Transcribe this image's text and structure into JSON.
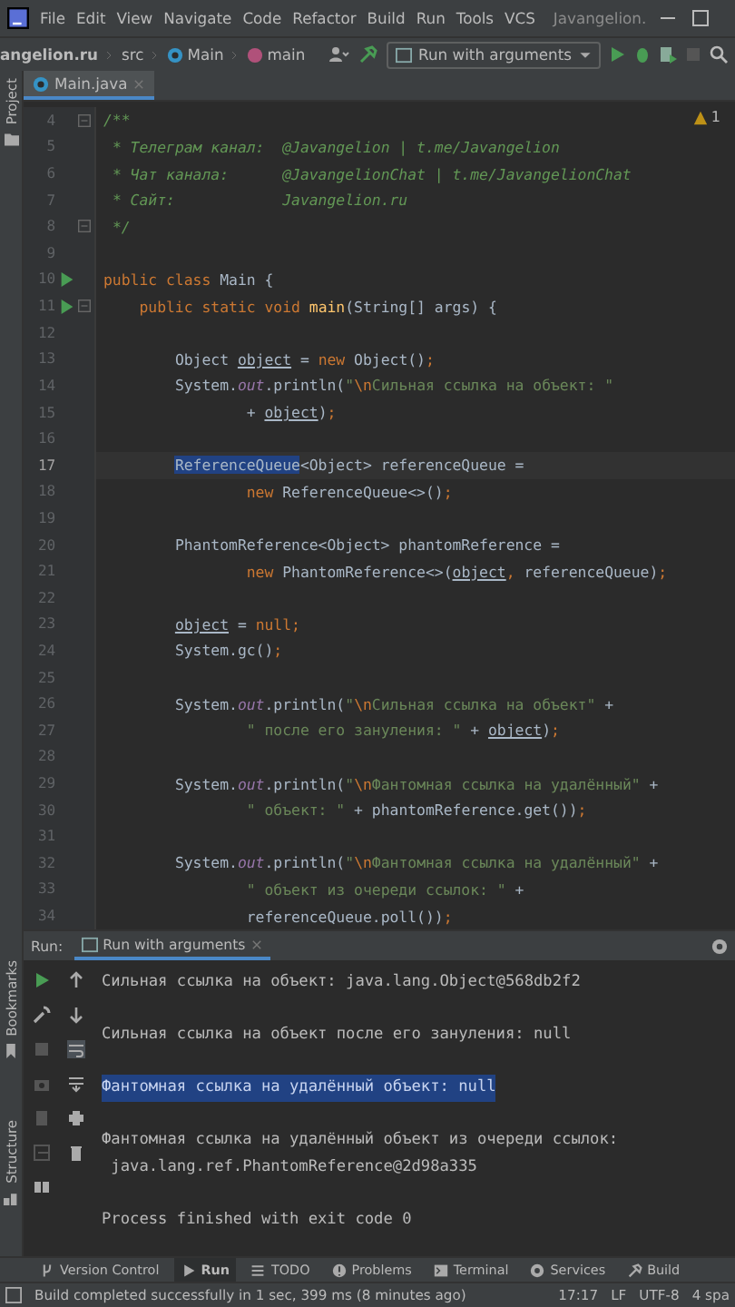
{
  "menu_bar": {
    "items": [
      "File",
      "Edit",
      "View",
      "Navigate",
      "Code",
      "Refactor",
      "Build",
      "Run",
      "Tools",
      "VCS"
    ],
    "title": "Javangelion."
  },
  "nav_bar": {
    "breadcrumbs": [
      {
        "label": "angelion.ru",
        "kind": "project"
      },
      {
        "label": "src",
        "kind": "folder"
      },
      {
        "label": "Main",
        "kind": "class"
      },
      {
        "label": "main",
        "kind": "method"
      }
    ],
    "run_config": "Run with arguments"
  },
  "editor_tabs": [
    {
      "label": "Main.java",
      "selected": true
    }
  ],
  "editor": {
    "warnings": "1",
    "lines": [
      {
        "number": "4",
        "current": false,
        "runnable": false,
        "foldable": true,
        "tokens": [
          {
            "kind": "doc",
            "text": "/**"
          }
        ]
      },
      {
        "number": "5",
        "current": false,
        "runnable": false,
        "foldable": false,
        "tokens": [
          {
            "kind": "doc",
            "text": " * Телеграм канал:  @Javangelion | t.me/Javangelion"
          }
        ]
      },
      {
        "number": "6",
        "current": false,
        "runnable": false,
        "foldable": false,
        "tokens": [
          {
            "kind": "doc",
            "text": " * Чат канала:      @JavangelionChat | t.me/JavangelionChat"
          }
        ]
      },
      {
        "number": "7",
        "current": false,
        "runnable": false,
        "foldable": false,
        "tokens": [
          {
            "kind": "doc",
            "text": " * Сайт:            Javangelion.ru"
          }
        ]
      },
      {
        "number": "8",
        "current": false,
        "runnable": false,
        "foldable": true,
        "tokens": [
          {
            "kind": "doc",
            "text": " */"
          }
        ]
      },
      {
        "number": "9",
        "current": false,
        "runnable": false,
        "foldable": false
      },
      {
        "number": "10",
        "current": false,
        "runnable": true,
        "foldable": false,
        "tokens": [
          {
            "kind": "kw",
            "text": "public class "
          },
          {
            "kind": "plain",
            "text": "Main {"
          }
        ]
      },
      {
        "number": "11",
        "current": false,
        "runnable": true,
        "foldable": true,
        "tokens": [
          {
            "kind": "kw",
            "text": "    public static void "
          },
          {
            "kind": "fn",
            "text": "main"
          },
          {
            "kind": "plain",
            "text": "(String[] args) {"
          }
        ]
      },
      {
        "number": "12",
        "current": false,
        "runnable": false,
        "foldable": false
      },
      {
        "number": "13",
        "current": false,
        "runnable": false,
        "foldable": false,
        "tokens": [
          {
            "kind": "plain",
            "text": "        Object "
          },
          {
            "kind": "var",
            "text": "object"
          },
          {
            "kind": "plain",
            "text": " = "
          },
          {
            "kind": "kw",
            "text": "new "
          },
          {
            "kind": "plain",
            "text": "Object()"
          },
          {
            "kind": "kw",
            "text": ";"
          }
        ]
      },
      {
        "number": "14",
        "current": false,
        "runnable": false,
        "foldable": false,
        "tokens": [
          {
            "kind": "plain",
            "text": "        System."
          },
          {
            "kind": "field",
            "text": "out"
          },
          {
            "kind": "plain",
            "text": ".println("
          },
          {
            "kind": "str",
            "text": "\""
          },
          {
            "kind": "esc",
            "text": "\\n"
          },
          {
            "kind": "str",
            "text": "Сильная ссылка на объект: \""
          }
        ]
      },
      {
        "number": "15",
        "current": false,
        "runnable": false,
        "foldable": false,
        "tokens": [
          {
            "kind": "plain",
            "text": "                + "
          },
          {
            "kind": "var",
            "text": "object"
          },
          {
            "kind": "plain",
            "text": ")"
          },
          {
            "kind": "kw",
            "text": ";"
          }
        ]
      },
      {
        "number": "16",
        "current": false,
        "runnable": false,
        "foldable": false
      },
      {
        "number": "17",
        "current": true,
        "runnable": false,
        "foldable": false,
        "tokens": [
          {
            "kind": "selected",
            "text": "        ReferenceQueue"
          },
          {
            "kind": "plain",
            "text": "<Object> referenceQueue ="
          }
        ]
      },
      {
        "number": "18",
        "current": false,
        "runnable": false,
        "foldable": false,
        "tokens": [
          {
            "kind": "kw",
            "text": "                new "
          },
          {
            "kind": "plain",
            "text": "ReferenceQueue<>()"
          },
          {
            "kind": "kw",
            "text": ";"
          }
        ]
      },
      {
        "number": "19",
        "current": false,
        "runnable": false,
        "foldable": false
      },
      {
        "number": "20",
        "current": false,
        "runnable": false,
        "foldable": false,
        "tokens": [
          {
            "kind": "plain",
            "text": "        PhantomReference<Object> phantomReference ="
          }
        ]
      },
      {
        "number": "21",
        "current": false,
        "runnable": false,
        "foldable": false,
        "tokens": [
          {
            "kind": "kw",
            "text": "                new "
          },
          {
            "kind": "plain",
            "text": "PhantomReference<>("
          },
          {
            "kind": "var",
            "text": "object"
          },
          {
            "kind": "kw",
            "text": ", "
          },
          {
            "kind": "plain",
            "text": "referenceQueue)"
          },
          {
            "kind": "kw",
            "text": ";"
          }
        ]
      },
      {
        "number": "22",
        "current": false,
        "runnable": false,
        "foldable": false
      },
      {
        "number": "23",
        "current": false,
        "runnable": false,
        "foldable": false,
        "tokens": [
          {
            "kind": "var",
            "text": "        object"
          },
          {
            "kind": "plain",
            "text": " = "
          },
          {
            "kind": "kw",
            "text": "null;"
          }
        ]
      },
      {
        "number": "24",
        "current": false,
        "runnable": false,
        "foldable": false,
        "tokens": [
          {
            "kind": "plain",
            "text": "        System.gc()"
          },
          {
            "kind": "kw",
            "text": ";"
          }
        ]
      },
      {
        "number": "25",
        "current": false,
        "runnable": false,
        "foldable": false
      },
      {
        "number": "26",
        "current": false,
        "runnable": false,
        "foldable": false,
        "tokens": [
          {
            "kind": "plain",
            "text": "        System."
          },
          {
            "kind": "field",
            "text": "out"
          },
          {
            "kind": "plain",
            "text": ".println("
          },
          {
            "kind": "str",
            "text": "\""
          },
          {
            "kind": "esc",
            "text": "\\n"
          },
          {
            "kind": "str",
            "text": "Сильная ссылка на объект\""
          },
          {
            "kind": "plain",
            "text": " +"
          }
        ]
      },
      {
        "number": "27",
        "current": false,
        "runnable": false,
        "foldable": false,
        "tokens": [
          {
            "kind": "str",
            "text": "                \" после его зануления: \""
          },
          {
            "kind": "plain",
            "text": " + "
          },
          {
            "kind": "var",
            "text": "object"
          },
          {
            "kind": "plain",
            "text": ")"
          },
          {
            "kind": "kw",
            "text": ";"
          }
        ]
      },
      {
        "number": "28",
        "current": false,
        "runnable": false,
        "foldable": false
      },
      {
        "number": "29",
        "current": false,
        "runnable": false,
        "foldable": false,
        "tokens": [
          {
            "kind": "plain",
            "text": "        System."
          },
          {
            "kind": "field",
            "text": "out"
          },
          {
            "kind": "plain",
            "text": ".println("
          },
          {
            "kind": "str",
            "text": "\""
          },
          {
            "kind": "esc",
            "text": "\\n"
          },
          {
            "kind": "str",
            "text": "Фантомная ссылка на удалённый\""
          },
          {
            "kind": "plain",
            "text": " +"
          }
        ]
      },
      {
        "number": "30",
        "current": false,
        "runnable": false,
        "foldable": false,
        "tokens": [
          {
            "kind": "str",
            "text": "                \" объект: \""
          },
          {
            "kind": "plain",
            "text": " + phantomReference.get())"
          },
          {
            "kind": "kw",
            "text": ";"
          }
        ]
      },
      {
        "number": "31",
        "current": false,
        "runnable": false,
        "foldable": false
      },
      {
        "number": "32",
        "current": false,
        "runnable": false,
        "foldable": false,
        "tokens": [
          {
            "kind": "plain",
            "text": "        System."
          },
          {
            "kind": "field",
            "text": "out"
          },
          {
            "kind": "plain",
            "text": ".println("
          },
          {
            "kind": "str",
            "text": "\""
          },
          {
            "kind": "esc",
            "text": "\\n"
          },
          {
            "kind": "str",
            "text": "Фантомная ссылка на удалённый\""
          },
          {
            "kind": "plain",
            "text": " +"
          }
        ]
      },
      {
        "number": "33",
        "current": false,
        "runnable": false,
        "foldable": false,
        "tokens": [
          {
            "kind": "str",
            "text": "                \" объект из очереди ссылок: \""
          },
          {
            "kind": "plain",
            "text": " +"
          }
        ]
      },
      {
        "number": "34",
        "current": false,
        "runnable": false,
        "foldable": false,
        "tokens": [
          {
            "kind": "plain",
            "text": "                referenceQueue.poll())"
          },
          {
            "kind": "kw",
            "text": ";"
          }
        ]
      }
    ]
  },
  "run_panel": {
    "label": "Run:",
    "tab": "Run with arguments",
    "console": [
      {
        "lines": [
          "Сильная ссылка на объект: java.lang.Object@568db2f2"
        ],
        "selected": false
      },
      {
        "lines": [
          "Сильная ссылка на объект после его зануления: null"
        ],
        "selected": false
      },
      {
        "lines": [
          "Фантомная ссылка на удалённый объект: null"
        ],
        "selected": true
      },
      {
        "lines": [
          "Фантомная ссылка на удалённый объект из очереди ссылок:",
          " java.lang.ref.PhantomReference@2d98a335"
        ],
        "selected": false
      },
      {
        "lines": [
          "Process finished with exit code 0"
        ],
        "selected": false
      }
    ]
  },
  "side_labels": {
    "top": "Project",
    "bottom": [
      "Bookmarks",
      "Structure"
    ]
  },
  "tool_tabs": [
    {
      "label": "Version Control",
      "kind": "vcs",
      "selected": false
    },
    {
      "label": "Run",
      "kind": "run",
      "selected": true
    },
    {
      "label": "TODO",
      "kind": "todo",
      "selected": false
    },
    {
      "label": "Problems",
      "kind": "problems",
      "selected": false
    },
    {
      "label": "Terminal",
      "kind": "terminal",
      "selected": false
    },
    {
      "label": "Services",
      "kind": "services",
      "selected": false
    },
    {
      "label": "Build",
      "kind": "build",
      "selected": false
    }
  ],
  "status_bar": {
    "message": "Build completed successfully in 1 sec, 399 ms (8 minutes ago)",
    "position": "17:17",
    "line_separator": "LF",
    "encoding": "UTF-8",
    "indent": "4 spa"
  }
}
